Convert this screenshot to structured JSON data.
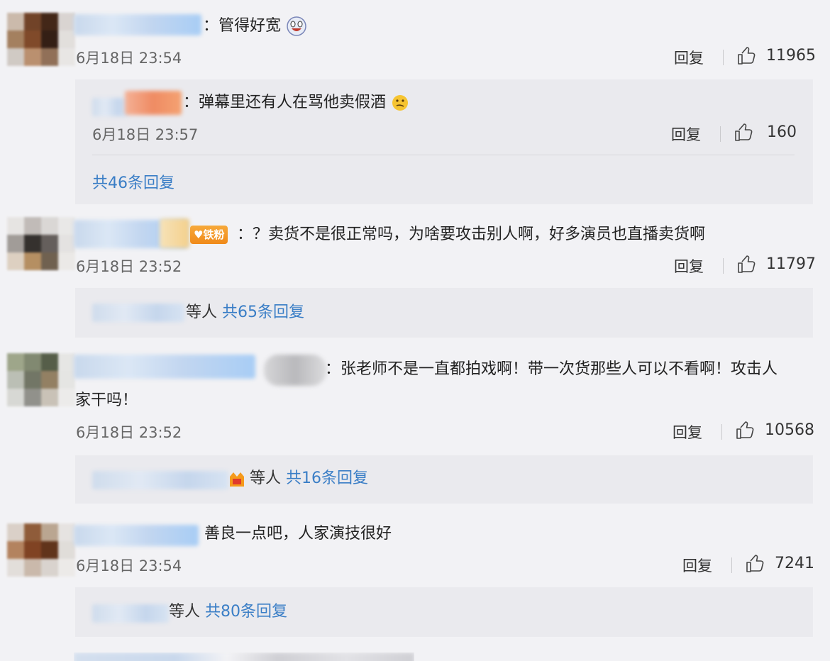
{
  "colors": {
    "link": "#3a7ec6",
    "background": "#f2f2f5",
    "reply_bg": "#eaeaee"
  },
  "comments": [
    {
      "text": "：管得好宽",
      "time": "6月18日 23:54",
      "reply_label": "回复",
      "likes": "11965",
      "sub_reply": {
        "text": "：弹幕里还有人在骂他卖假酒",
        "time": "6月18日 23:57",
        "reply_label": "回复",
        "likes": "160"
      },
      "total": "共46条回复"
    },
    {
      "badge": "铁粉",
      "text": "：？卖货不是很正常吗，为啥要攻击别人啊，好多演员也直播卖货啊",
      "time": "6月18日 23:52",
      "reply_label": "回复",
      "likes": "11797",
      "others": "等人",
      "total": "共65条回复"
    },
    {
      "text": "：张老师不是一直都拍戏啊！带一次货那些人可以不看啊！攻击人",
      "text2": "家干吗！",
      "time": "6月18日 23:52",
      "reply_label": "回复",
      "likes": "10568",
      "others": "等人",
      "total": "共16条回复"
    },
    {
      "text": "善良一点吧，人家演技很好",
      "time": "6月18日 23:54",
      "reply_label": "回复",
      "likes": "7241",
      "others": "等人",
      "total": "共80条回复"
    }
  ],
  "icons": {
    "like": "thumbs-up-icon",
    "emoji_laugh": "laughing-face-icon",
    "emoji_think": "thinking-face-icon",
    "badge_icon": "fan-badge-icon"
  }
}
